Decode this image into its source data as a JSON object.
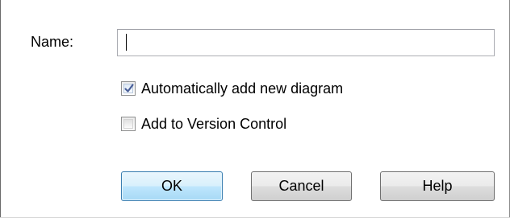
{
  "dialog": {
    "name_label": "Name:",
    "name_value": "",
    "auto_add_label": "Automatically add new diagram",
    "auto_add_checked": true,
    "version_control_label": "Add to Version Control",
    "version_control_checked": false,
    "ok_label": "OK",
    "cancel_label": "Cancel",
    "help_label": "Help"
  },
  "colors": {
    "ok_border": "#3c7fb1",
    "checkmark": "#4a5f97"
  },
  "icons": {
    "auto_add": "checkmark-icon"
  }
}
